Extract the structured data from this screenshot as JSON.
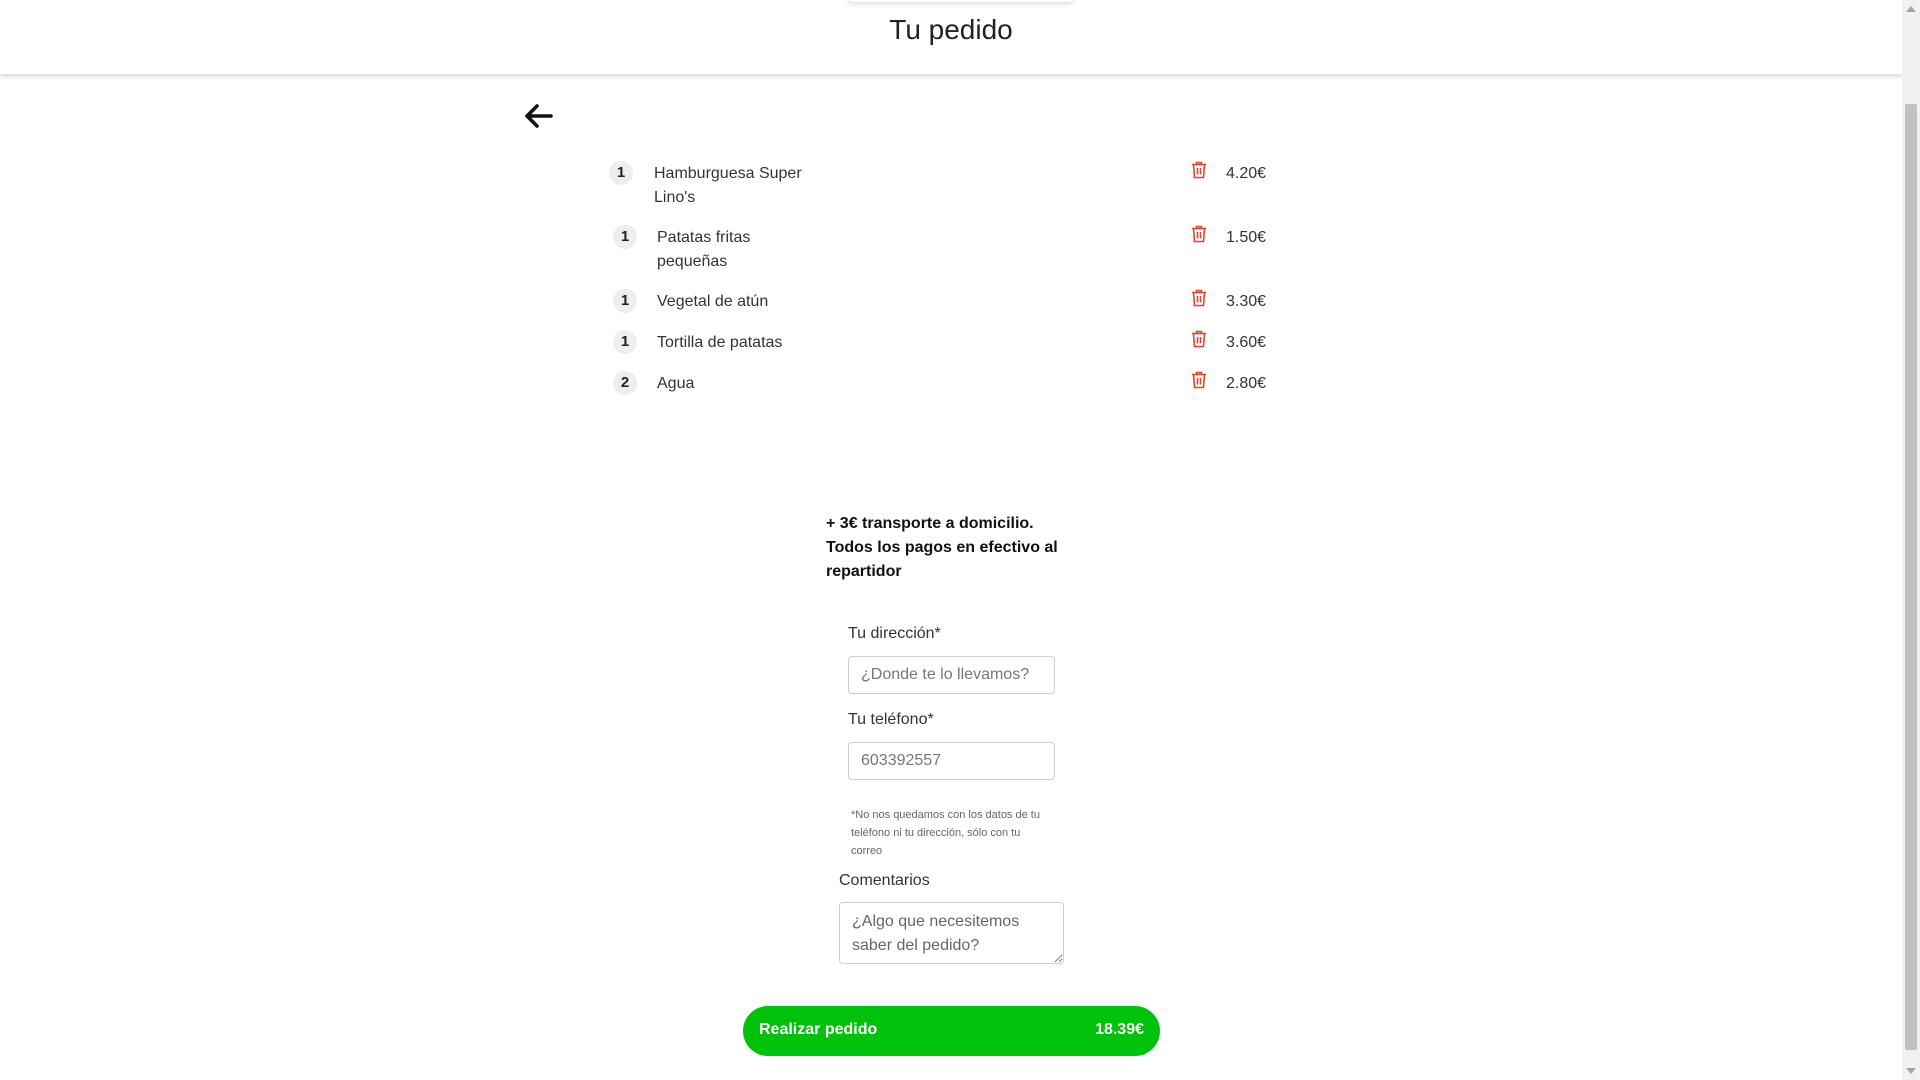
{
  "header": {
    "title": "Tu pedido"
  },
  "back": {
    "icon": "arrow-left-icon"
  },
  "items": [
    {
      "qty": "1",
      "name": "Hamburguesa Super Lino's",
      "price": "4.20€"
    },
    {
      "qty": "1",
      "name": "Patatas fritas pequeñas",
      "price": "1.50€"
    },
    {
      "qty": "1",
      "name": "Vegetal de atún",
      "price": "3.30€"
    },
    {
      "qty": "1",
      "name": "Tortilla de patatas",
      "price": "3.60€"
    },
    {
      "qty": "2",
      "name": "Agua",
      "price": "2.80€"
    }
  ],
  "delivery_note": "+ 3€ transporte a domicilio. Todos los pagos en efectivo al repartidor",
  "form": {
    "address_label": "Tu dirección*",
    "address_placeholder": "¿Donde te lo llevamos?",
    "phone_label": "Tu teléfono*",
    "phone_value": "603392557",
    "privacy_note": "*No nos quedamos con los datos de tu teléfono ni tu dirección, sólo con tu correo",
    "comments_label": "Comentarios",
    "comments_placeholder": "¿Algo que necesitemos saber del pedido?"
  },
  "order_button": {
    "label": "Realizar pedido",
    "total": "18.39€"
  },
  "colors": {
    "accent_green": "#00c20a",
    "trash_red": "#e0452c"
  }
}
